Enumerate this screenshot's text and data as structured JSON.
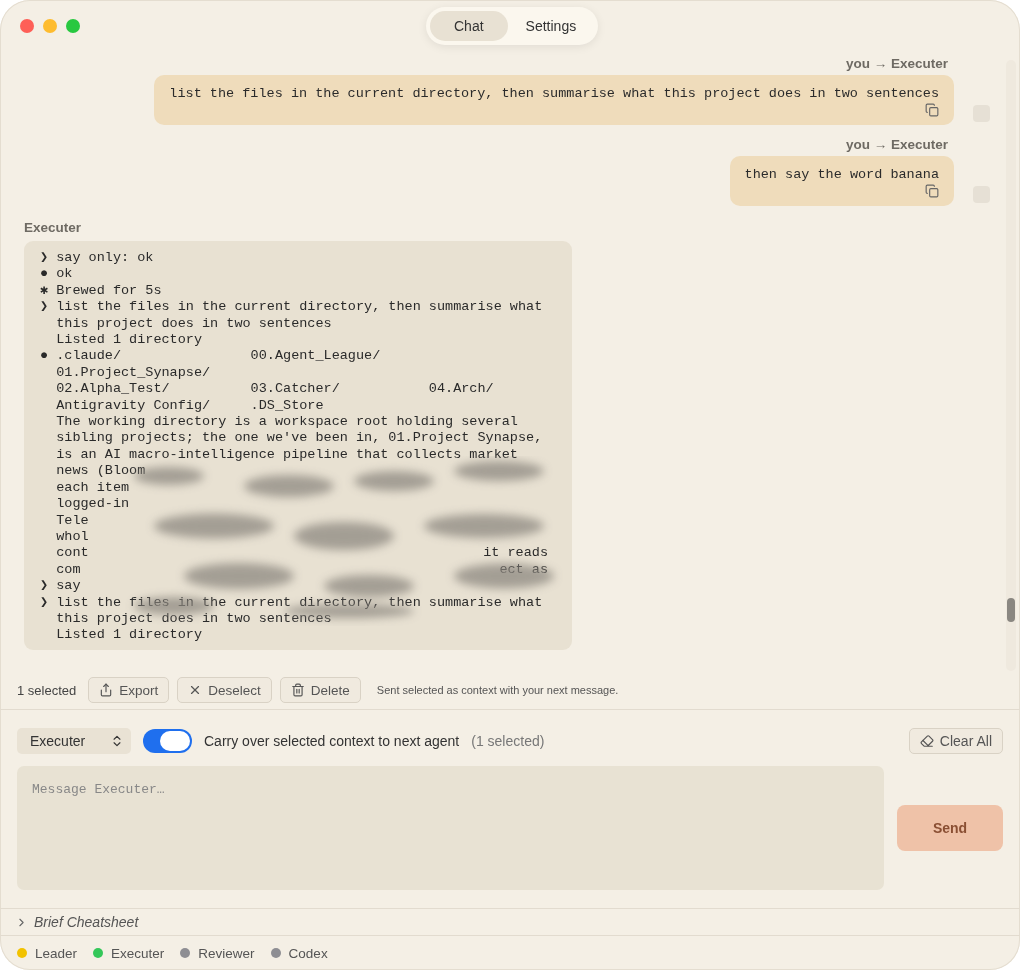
{
  "window": {
    "tabs": [
      {
        "label": "Chat",
        "selected": true
      },
      {
        "label": "Settings",
        "selected": false
      }
    ]
  },
  "messages": [
    {
      "kind": "user",
      "sender": "you → Executer",
      "text": "list the files in the current directory, then summarise what this project does in two sentences",
      "selected": false
    },
    {
      "kind": "user",
      "sender": "you → Executer",
      "text": "then say the word banana",
      "selected": false
    },
    {
      "kind": "agent",
      "sender": "Executer",
      "lines": [
        {
          "marker": "❯",
          "text": "say only: ok"
        },
        {
          "marker": "●",
          "text": "ok"
        },
        {
          "marker": "✱",
          "text": "Brewed for 5s"
        },
        {
          "marker": "❯",
          "text": "list the files in the current directory, then summarise what"
        },
        {
          "text": "this project does in two sentences"
        },
        {
          "text": "Listed 1 directory"
        },
        {
          "marker": "●",
          "text": ".claude/                00.Agent_League/"
        },
        {
          "text": "01.Project_Synapse/"
        },
        {
          "text": "02.Alpha_Test/          03.Catcher/           04.Arch/"
        },
        {
          "text": "Antigravity Config/     .DS_Store"
        },
        {
          "text": "The working directory is a workspace root holding several"
        },
        {
          "text": "sibling projects; the one we've been in, 01.Project Synapse,"
        },
        {
          "text": "is an AI macro-intelligence pipeline that collects market"
        },
        {
          "text": "news (Bloom"
        },
        {
          "text": "each item"
        },
        {
          "text": "logged-in"
        },
        {
          "text": "Tele"
        },
        {
          "text": "whol"
        },
        {
          "text": "cont",
          "tail": "it reads"
        },
        {
          "text": "com",
          "tail": "ect as"
        },
        {
          "marker": "❯",
          "text": "say"
        },
        {
          "marker": "❯",
          "text": "list the files in the current directory, then summarise what"
        },
        {
          "text": "this project does in two sentences"
        },
        {
          "text": "Listed 1 directory"
        }
      ]
    }
  ],
  "selection_bar": {
    "count": "1 selected",
    "buttons": [
      {
        "kind": "export",
        "label": "Export"
      },
      {
        "kind": "deselect",
        "label": "Deselect"
      },
      {
        "kind": "delete",
        "label": "Delete"
      }
    ],
    "note": "Sent selected as context with your next message."
  },
  "composer": {
    "agent": "Executer",
    "carry_over": {
      "on": true,
      "label": "Carry over selected context to next agent",
      "count": "(1 selected)"
    },
    "clear_button": "Clear All",
    "placeholder": "Message Executer…",
    "send": {
      "label": "Send",
      "disabled": true
    }
  },
  "cheatsheet": {
    "label": "Brief Cheatsheet",
    "expanded": false
  },
  "agents": [
    {
      "name": "Leader",
      "color": "#f2c200"
    },
    {
      "name": "Executer",
      "color": "#34c759"
    },
    {
      "name": "Reviewer",
      "color": "#8e8e93"
    },
    {
      "name": "Codex",
      "color": "#8e8e93"
    }
  ]
}
